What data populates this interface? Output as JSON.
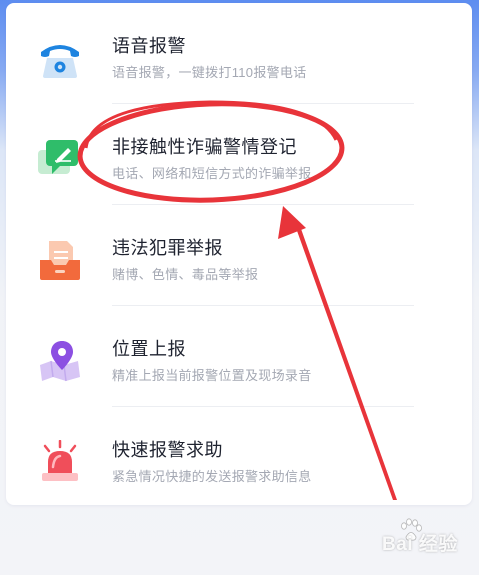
{
  "menu": {
    "items": [
      {
        "title": "语音报警",
        "desc": "语音报警，一键拨打110报警电话",
        "icon": "telephone-icon"
      },
      {
        "title": "非接触性诈骗警情登记",
        "desc": "电话、网络和短信方式的诈骗举报",
        "icon": "chat-edit-icon"
      },
      {
        "title": "违法犯罪举报",
        "desc": "赌博、色情、毒品等举报",
        "icon": "document-tray-icon"
      },
      {
        "title": "位置上报",
        "desc": "精准上报当前报警位置及现场录音",
        "icon": "map-pin-icon"
      },
      {
        "title": "快速报警求助",
        "desc": "紧急情况快捷的发送报警求助信息",
        "icon": "siren-icon"
      }
    ]
  },
  "watermark": {
    "text": "Bai 经验"
  },
  "colors": {
    "annotation": "#e8343a",
    "title": "#1f2330",
    "desc": "#a4a8b3"
  }
}
